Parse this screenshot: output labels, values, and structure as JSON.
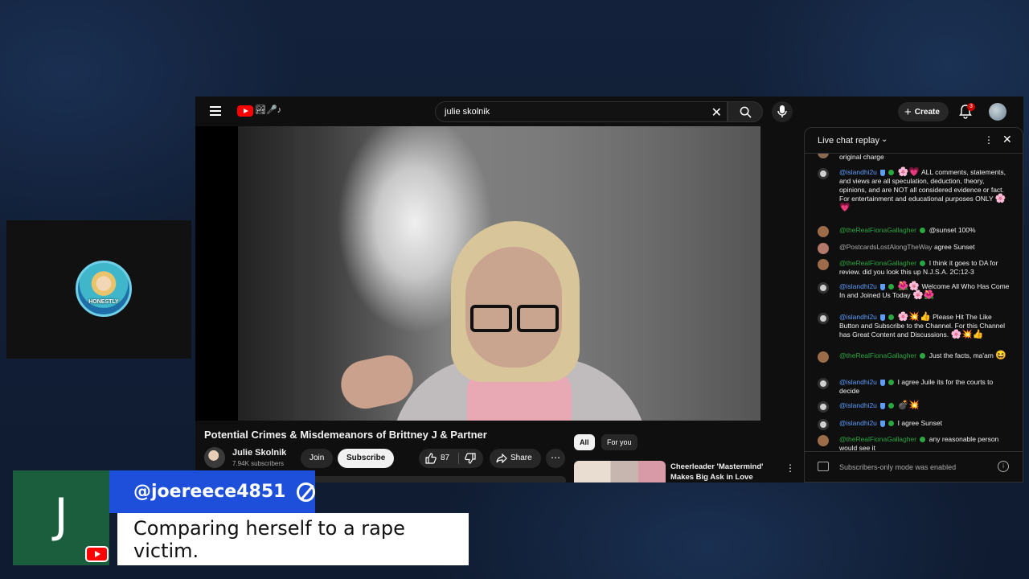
{
  "topbar": {
    "search_value": "julie skolnik",
    "create_label": "Create",
    "notification_count": "3"
  },
  "video": {
    "title": "Potential Crimes & Misdemeanors of Brittney J & Partner",
    "channel_name": "Julie Skolnik",
    "subscribers": "7.94K subscribers",
    "join_label": "Join",
    "subscribe_label": "Subscribe",
    "like_count": "87",
    "share_label": "Share"
  },
  "recommendations": {
    "chips": [
      "All",
      "For you"
    ],
    "first_title": "Cheerleader 'Mastermind' Makes Big Ask in Love Triangl..."
  },
  "chat": {
    "title": "Live chat replay",
    "footer": "Subscribers-only mode was enabled",
    "messages": [
      {
        "author": "",
        "text": "original charge"
      },
      {
        "author": "@islandhi2u",
        "text": "ALL comments, statements, and views are all speculation, deduction, theory, opinions, and are NOT all considered evidence or fact. For entertainment and educational purposes ONLY"
      },
      {
        "author": "@theRealFionaGallagher",
        "text": "@sunset 100%"
      },
      {
        "author": "@PostcardsLostAlongTheWay",
        "text": "agree Sunset"
      },
      {
        "author": "@theRealFionaGallagher",
        "text": "I think it goes to DA for review. did you look this up N.J.S.A. 2C:12-3"
      },
      {
        "author": "@islandhi2u",
        "text": "Welcome All Who Has Come In and Joined Us Today"
      },
      {
        "author": "@islandhi2u",
        "text": "Please Hit The Like Button and Subscribe to the Channel. For this Channel has Great Content and Discussions."
      },
      {
        "author": "@theRealFionaGallagher",
        "text": "Just the facts, ma'am"
      },
      {
        "author": "@islandhi2u",
        "text": "I agree Juile its for the courts to decide"
      },
      {
        "author": "@islandhi2u",
        "text": ""
      },
      {
        "author": "@islandhi2u",
        "text": "I agree Sunset"
      },
      {
        "author": "@theRealFionaGallagher",
        "text": "any reasonable person would see it"
      }
    ]
  },
  "overlay": {
    "avatar_letter": "J",
    "username": "@joereece4851",
    "comment": "Comparing herself to a rape victim."
  },
  "cam": {
    "logo_text": "HONESTLY"
  },
  "colors": {
    "brand_red": "#ff0000",
    "overlay_blue": "#1d4fdb",
    "overlay_green": "#1b5e3e",
    "author_blue": "#5e9eff",
    "author_green": "#2ba640"
  }
}
